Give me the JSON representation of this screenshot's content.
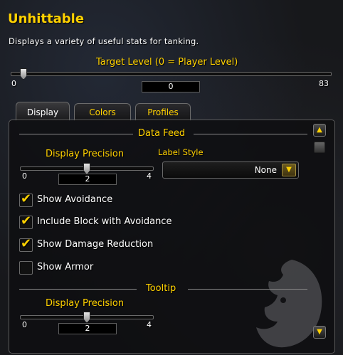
{
  "header": {
    "title": "Unhittable",
    "subtitle": "Displays a variety of useful stats for tanking."
  },
  "target_level": {
    "label": "Target Level (0 = Player Level)",
    "min": "0",
    "max": "83",
    "value": "0",
    "fraction": 0.0
  },
  "tabs": [
    {
      "label": "Display",
      "active": true
    },
    {
      "label": "Colors",
      "active": false
    },
    {
      "label": "Profiles",
      "active": false
    }
  ],
  "data_feed": {
    "header": "Data Feed",
    "precision": {
      "label": "Display Precision",
      "min": "0",
      "max": "4",
      "value": "2",
      "fraction": 0.5
    },
    "label_style": {
      "label": "Label Style",
      "selected": "None"
    },
    "checkboxes": [
      {
        "label": "Show Avoidance",
        "checked": true
      },
      {
        "label": "Include Block with Avoidance",
        "checked": true
      },
      {
        "label": "Show Damage Reduction",
        "checked": true
      },
      {
        "label": "Show Armor",
        "checked": false
      }
    ]
  },
  "tooltip": {
    "header": "Tooltip",
    "precision": {
      "label": "Display Precision",
      "min": "0",
      "max": "4",
      "value": "2",
      "fraction": 0.5
    }
  },
  "colors": {
    "gold": "#ffd100",
    "white": "#ffffff"
  }
}
